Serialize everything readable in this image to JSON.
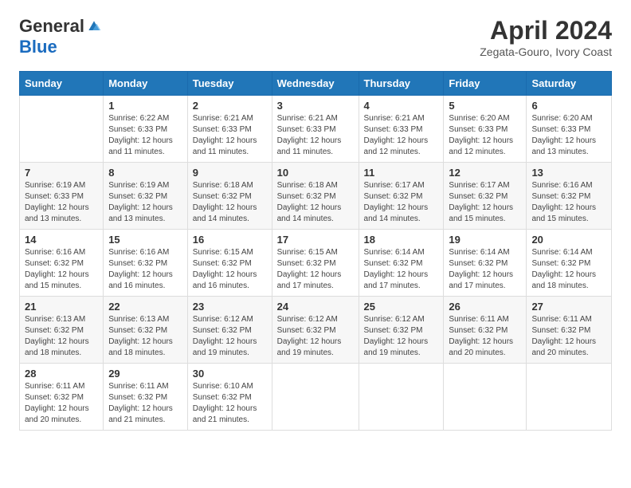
{
  "header": {
    "logo_general": "General",
    "logo_blue": "Blue",
    "month_title": "April 2024",
    "location": "Zegata-Gouro, Ivory Coast"
  },
  "weekdays": [
    "Sunday",
    "Monday",
    "Tuesday",
    "Wednesday",
    "Thursday",
    "Friday",
    "Saturday"
  ],
  "weeks": [
    [
      {
        "day": "",
        "info": ""
      },
      {
        "day": "1",
        "info": "Sunrise: 6:22 AM\nSunset: 6:33 PM\nDaylight: 12 hours\nand 11 minutes."
      },
      {
        "day": "2",
        "info": "Sunrise: 6:21 AM\nSunset: 6:33 PM\nDaylight: 12 hours\nand 11 minutes."
      },
      {
        "day": "3",
        "info": "Sunrise: 6:21 AM\nSunset: 6:33 PM\nDaylight: 12 hours\nand 11 minutes."
      },
      {
        "day": "4",
        "info": "Sunrise: 6:21 AM\nSunset: 6:33 PM\nDaylight: 12 hours\nand 12 minutes."
      },
      {
        "day": "5",
        "info": "Sunrise: 6:20 AM\nSunset: 6:33 PM\nDaylight: 12 hours\nand 12 minutes."
      },
      {
        "day": "6",
        "info": "Sunrise: 6:20 AM\nSunset: 6:33 PM\nDaylight: 12 hours\nand 13 minutes."
      }
    ],
    [
      {
        "day": "7",
        "info": "Sunrise: 6:19 AM\nSunset: 6:33 PM\nDaylight: 12 hours\nand 13 minutes."
      },
      {
        "day": "8",
        "info": "Sunrise: 6:19 AM\nSunset: 6:32 PM\nDaylight: 12 hours\nand 13 minutes."
      },
      {
        "day": "9",
        "info": "Sunrise: 6:18 AM\nSunset: 6:32 PM\nDaylight: 12 hours\nand 14 minutes."
      },
      {
        "day": "10",
        "info": "Sunrise: 6:18 AM\nSunset: 6:32 PM\nDaylight: 12 hours\nand 14 minutes."
      },
      {
        "day": "11",
        "info": "Sunrise: 6:17 AM\nSunset: 6:32 PM\nDaylight: 12 hours\nand 14 minutes."
      },
      {
        "day": "12",
        "info": "Sunrise: 6:17 AM\nSunset: 6:32 PM\nDaylight: 12 hours\nand 15 minutes."
      },
      {
        "day": "13",
        "info": "Sunrise: 6:16 AM\nSunset: 6:32 PM\nDaylight: 12 hours\nand 15 minutes."
      }
    ],
    [
      {
        "day": "14",
        "info": "Sunrise: 6:16 AM\nSunset: 6:32 PM\nDaylight: 12 hours\nand 15 minutes."
      },
      {
        "day": "15",
        "info": "Sunrise: 6:16 AM\nSunset: 6:32 PM\nDaylight: 12 hours\nand 16 minutes."
      },
      {
        "day": "16",
        "info": "Sunrise: 6:15 AM\nSunset: 6:32 PM\nDaylight: 12 hours\nand 16 minutes."
      },
      {
        "day": "17",
        "info": "Sunrise: 6:15 AM\nSunset: 6:32 PM\nDaylight: 12 hours\nand 17 minutes."
      },
      {
        "day": "18",
        "info": "Sunrise: 6:14 AM\nSunset: 6:32 PM\nDaylight: 12 hours\nand 17 minutes."
      },
      {
        "day": "19",
        "info": "Sunrise: 6:14 AM\nSunset: 6:32 PM\nDaylight: 12 hours\nand 17 minutes."
      },
      {
        "day": "20",
        "info": "Sunrise: 6:14 AM\nSunset: 6:32 PM\nDaylight: 12 hours\nand 18 minutes."
      }
    ],
    [
      {
        "day": "21",
        "info": "Sunrise: 6:13 AM\nSunset: 6:32 PM\nDaylight: 12 hours\nand 18 minutes."
      },
      {
        "day": "22",
        "info": "Sunrise: 6:13 AM\nSunset: 6:32 PM\nDaylight: 12 hours\nand 18 minutes."
      },
      {
        "day": "23",
        "info": "Sunrise: 6:12 AM\nSunset: 6:32 PM\nDaylight: 12 hours\nand 19 minutes."
      },
      {
        "day": "24",
        "info": "Sunrise: 6:12 AM\nSunset: 6:32 PM\nDaylight: 12 hours\nand 19 minutes."
      },
      {
        "day": "25",
        "info": "Sunrise: 6:12 AM\nSunset: 6:32 PM\nDaylight: 12 hours\nand 19 minutes."
      },
      {
        "day": "26",
        "info": "Sunrise: 6:11 AM\nSunset: 6:32 PM\nDaylight: 12 hours\nand 20 minutes."
      },
      {
        "day": "27",
        "info": "Sunrise: 6:11 AM\nSunset: 6:32 PM\nDaylight: 12 hours\nand 20 minutes."
      }
    ],
    [
      {
        "day": "28",
        "info": "Sunrise: 6:11 AM\nSunset: 6:32 PM\nDaylight: 12 hours\nand 20 minutes."
      },
      {
        "day": "29",
        "info": "Sunrise: 6:11 AM\nSunset: 6:32 PM\nDaylight: 12 hours\nand 21 minutes."
      },
      {
        "day": "30",
        "info": "Sunrise: 6:10 AM\nSunset: 6:32 PM\nDaylight: 12 hours\nand 21 minutes."
      },
      {
        "day": "",
        "info": ""
      },
      {
        "day": "",
        "info": ""
      },
      {
        "day": "",
        "info": ""
      },
      {
        "day": "",
        "info": ""
      }
    ]
  ]
}
